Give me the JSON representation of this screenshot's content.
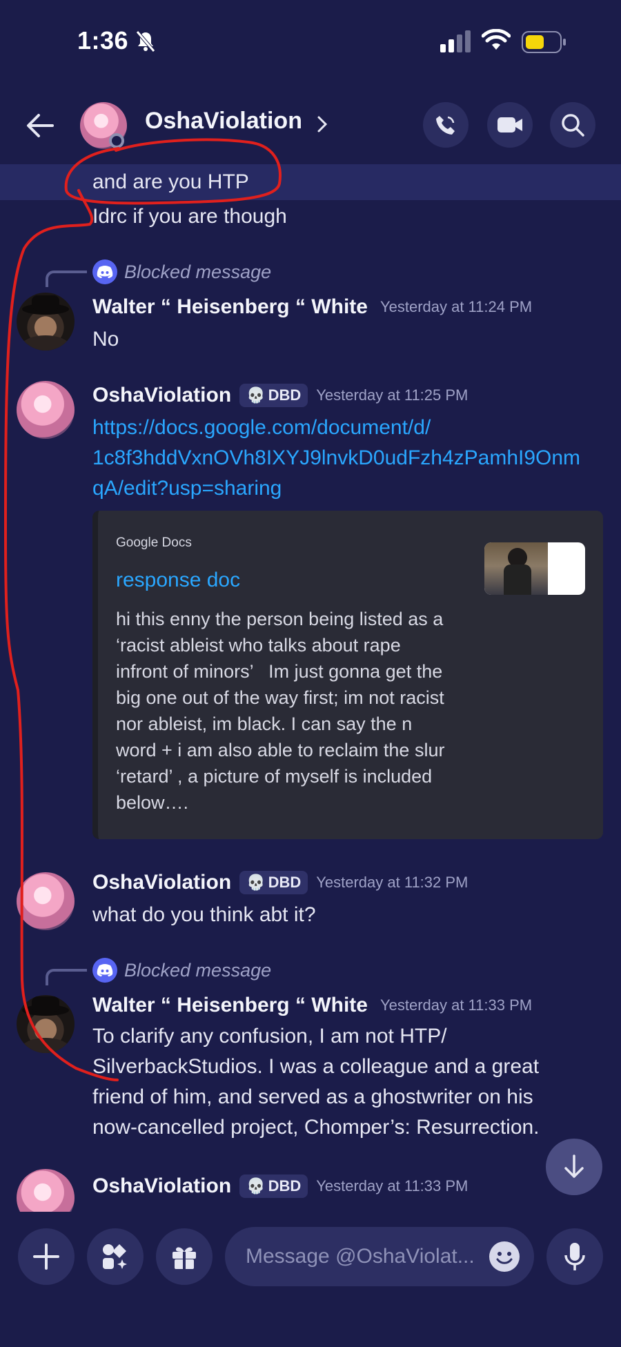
{
  "status_bar": {
    "time": "1:36"
  },
  "header": {
    "username": "OshaViolation"
  },
  "messages": {
    "prev_line_1": "and are you HTP",
    "prev_line_2": "Idrc if you are though",
    "blocked_1": "Blocked message",
    "walter_1": {
      "name": "Walter “ Heisenberg “ White",
      "time": "Yesterday at 11:24 PM",
      "text": "No"
    },
    "osha_1": {
      "name": "OshaViolation",
      "badge": "DBD",
      "time": "Yesterday at 11:25 PM",
      "link_line_1": "https://docs.google.com/document/d/",
      "link_line_2": "1c8f3hddVxnOVh8IXYJ9lnvkD0udFzh4zPamhI9Onm",
      "link_line_3": "qA/edit?usp=sharing"
    },
    "embed": {
      "provider": "Google Docs",
      "title": "response doc",
      "desc_lines": [
        "hi this enny the person being listed as a",
        "‘racist ableist who talks about rape",
        "infront of minors’   Im just gonna get the",
        "big one out of the way first; im not racist",
        "nor ableist, im black. I can say the n",
        "word + i am also able to reclaim the slur",
        "‘retard’ , a picture of myself is included",
        "below…."
      ]
    },
    "osha_2": {
      "name": "OshaViolation",
      "badge": "DBD",
      "time": "Yesterday at 11:32 PM",
      "text": "what do you think abt it?"
    },
    "blocked_2": "Blocked message",
    "walter_2": {
      "name": "Walter “ Heisenberg “ White",
      "time": "Yesterday at 11:33 PM",
      "lines": [
        "To clarify any confusion, I am not HTP/",
        "SilverbackStudios. I was a colleague and a great",
        "friend of him, and served as a ghostwriter on his",
        "now-cancelled project, Chomper’s: Resurrection."
      ]
    },
    "osha_3": {
      "name": "OshaViolation",
      "badge": "DBD",
      "time": "Yesterday at 11:33 PM"
    }
  },
  "composer": {
    "placeholder": "Message @OshaViolat..."
  },
  "colors": {
    "background": "#1b1c4a",
    "link": "#2aa7ff",
    "annotation": "#e0201d",
    "battery": "#f5d60a"
  }
}
